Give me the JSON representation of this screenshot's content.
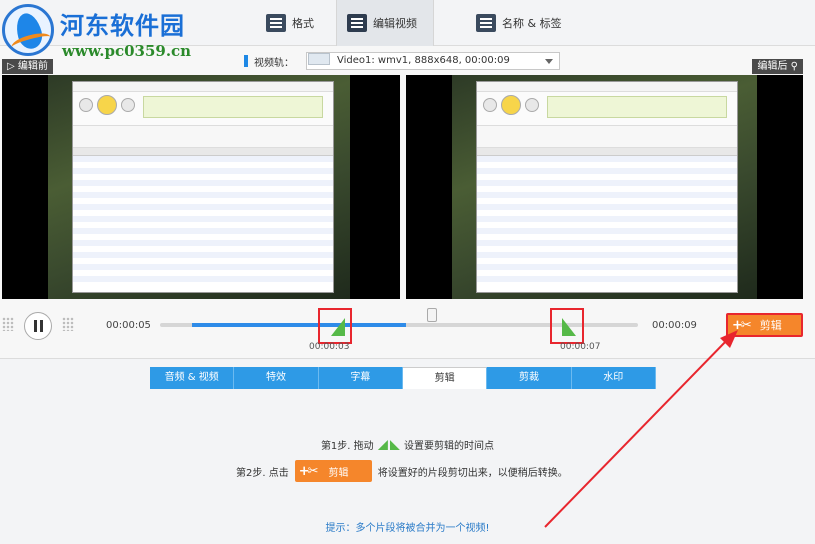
{
  "watermark": {
    "title": "河东软件园",
    "url": "www.pc0359.cn"
  },
  "tabs": [
    {
      "label": "格式"
    },
    {
      "label": "编辑视频"
    },
    {
      "label": "名称 & 标签"
    }
  ],
  "track": {
    "label": "视频轨：",
    "selected": "Video1: wmv1, 888x648, 00:00:09"
  },
  "preview": {
    "before_label": "▷ 编辑前",
    "after_label": "编辑后"
  },
  "timeline": {
    "current_time": "00:00:05",
    "end_time": "00:00:09",
    "cut_start_time": "00:00:03",
    "cut_end_time": "00:00:07",
    "cut_button_label": "剪辑"
  },
  "subtabs": [
    {
      "label": "音频 & 视频"
    },
    {
      "label": "特效"
    },
    {
      "label": "字幕"
    },
    {
      "label": "剪辑"
    },
    {
      "label": "剪裁"
    },
    {
      "label": "水印"
    }
  ],
  "instructions": {
    "step1_prefix": "第1步. 拖动",
    "step1_suffix": "设置要剪辑的时间点",
    "step2_prefix": "第2步. 点击",
    "step2_button": "剪辑",
    "step2_suffix": "将设置好的片段剪切出来，以便稍后转换。",
    "tip": "提示：多个片段将被合并为一个视频!"
  },
  "colors": {
    "accent": "#2e9ae6",
    "cut_button": "#f5862b",
    "handle": "#56b948",
    "highlight": "#e8262e"
  }
}
